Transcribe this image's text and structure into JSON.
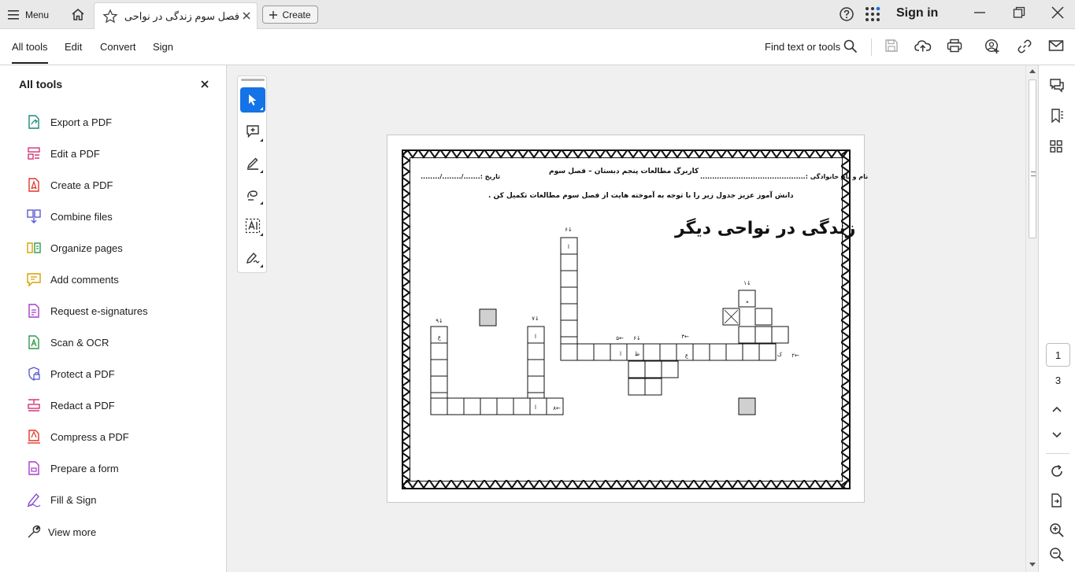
{
  "titlebar": {
    "menu_label": "Menu",
    "tab_title": "فصل سوم زندگی در نواحی د..",
    "create_label": "Create",
    "signin_label": "Sign in"
  },
  "toolbar": {
    "items": [
      "All tools",
      "Edit",
      "Convert",
      "Sign"
    ],
    "active": "All tools",
    "find_label": "Find text or tools"
  },
  "left_panel": {
    "title": "All tools",
    "tools": [
      {
        "label": "Export a PDF",
        "icon": "export-pdf-icon",
        "color": "#1a8a7a"
      },
      {
        "label": "Edit a PDF",
        "icon": "edit-pdf-icon",
        "color": "#d6337a"
      },
      {
        "label": "Create a PDF",
        "icon": "create-pdf-icon",
        "color": "#e0352b"
      },
      {
        "label": "Combine files",
        "icon": "combine-files-icon",
        "color": "#5b5bd6"
      },
      {
        "label": "Organize pages",
        "icon": "organize-pages-icon",
        "color": "#2e9a4a"
      },
      {
        "label": "Add comments",
        "icon": "add-comments-icon",
        "color": "#d8a000"
      },
      {
        "label": "Request e-signatures",
        "icon": "request-esign-icon",
        "color": "#a83bc8"
      },
      {
        "label": "Scan & OCR",
        "icon": "scan-ocr-icon",
        "color": "#2e9a4a"
      },
      {
        "label": "Protect a PDF",
        "icon": "protect-pdf-icon",
        "color": "#5b5bd6"
      },
      {
        "label": "Redact a PDF",
        "icon": "redact-pdf-icon",
        "color": "#d6337a"
      },
      {
        "label": "Compress a PDF",
        "icon": "compress-pdf-icon",
        "color": "#e0352b"
      },
      {
        "label": "Prepare a form",
        "icon": "prepare-form-icon",
        "color": "#a83bc8"
      },
      {
        "label": "Fill & Sign",
        "icon": "fill-sign-icon",
        "color": "#8a4bd6"
      },
      {
        "label": "View more",
        "icon": "wrench-icon",
        "color": "#333333"
      }
    ]
  },
  "document": {
    "header_center": "کاربرگ مطالعات پنجم دبستان – فصل سوم",
    "header_right": "نام و نام خانوادگی :............................................",
    "header_left": "تاریخ :......./......../........",
    "instruction": "دانش آموز عزیز جدول زیر را با توجه به آموخته هایت از فصل سوم مطالعات تکمیل کن .",
    "title": "زندگی در نواحی دیگر",
    "clue_numbers": [
      "۱",
      "۲",
      "۳",
      "۴",
      "۵",
      "۶",
      "۷",
      "۸",
      "۹"
    ],
    "cell_letters": [
      "ا",
      "ه",
      "ک",
      "ع",
      "ا",
      "ظ",
      "ا",
      "ا",
      "ع"
    ]
  },
  "page_nav": {
    "current": "1",
    "total": "3"
  },
  "colors": {
    "accent": "#1473e6",
    "brand_red": "#e0352b"
  }
}
